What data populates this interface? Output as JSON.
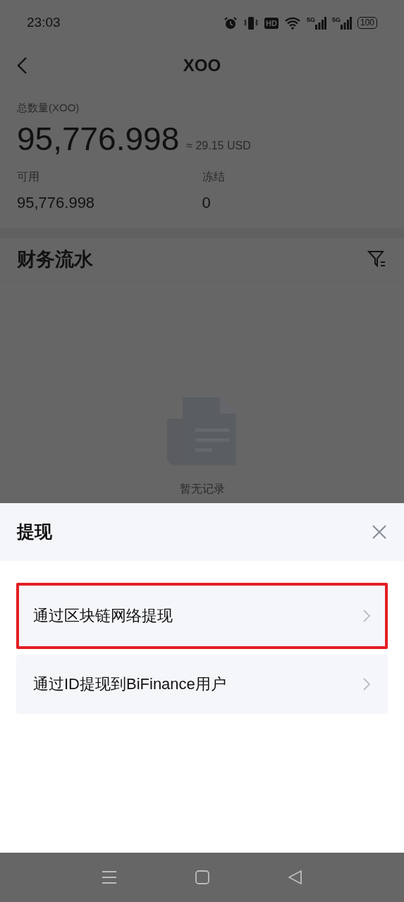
{
  "status_bar": {
    "time": "23:03",
    "hd": "HD",
    "signals": [
      "5G",
      "5G"
    ],
    "battery": "100"
  },
  "header": {
    "title": "XOO"
  },
  "summary": {
    "total_label": "总数量(XOO)",
    "total": "95,776.998",
    "fiat": "≈ 29.15 USD",
    "balances": [
      {
        "label": "可用",
        "value": "95,776.998"
      },
      {
        "label": "冻结",
        "value": "0"
      }
    ]
  },
  "ledger": {
    "title": "财务流水",
    "empty_text": "暂无记录"
  },
  "sheet": {
    "title": "提现",
    "options": [
      {
        "label": "通过区块链网络提现",
        "highlighted": true
      },
      {
        "label": "通过ID提现到BiFinance用户",
        "highlighted": false
      }
    ]
  }
}
